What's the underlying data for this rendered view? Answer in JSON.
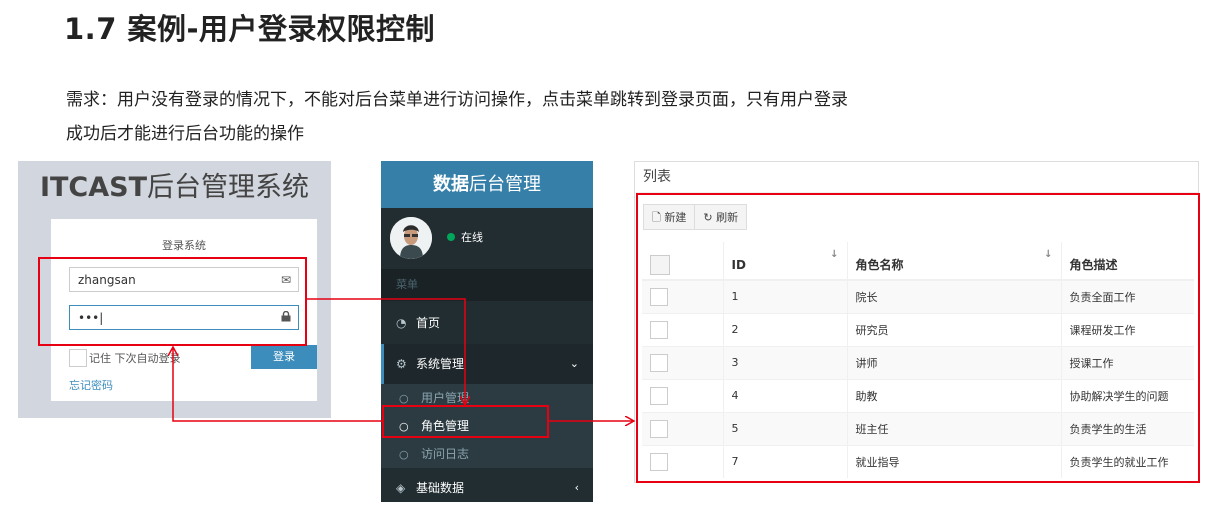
{
  "title": "1.7 案例-用户登录权限控制",
  "description": {
    "line1": "需求：用户没有登录的情况下，不能对后台菜单进行访问操作，点击菜单跳转到登录页面，只有用户登录",
    "line2": "成功后才能进行后台功能的操作"
  },
  "login": {
    "logo_bold": "ITCAST",
    "logo_rest": "后台管理系统",
    "box_msg": "登录系统",
    "username_value": "zhangsan",
    "password_value": "•••",
    "remember_label": "记住 下次自动登录",
    "login_button": "登录",
    "forgot_link": "忘记密码",
    "icons": {
      "username": "envelope-icon",
      "password": "lock-icon"
    }
  },
  "sidebar": {
    "logo_bold": "数据",
    "logo_rest": "后台管理",
    "status": "在线",
    "header": "菜单",
    "home": "首页",
    "system": "系统管理",
    "sub_items": [
      "用户管理",
      "角色管理",
      "访问日志"
    ],
    "basic": "基础数据"
  },
  "list": {
    "header": "列表",
    "new_button": "新建",
    "refresh_button": "刷新",
    "columns": [
      "ID",
      "角色名称",
      "角色描述"
    ],
    "rows": [
      {
        "id": "1",
        "name": "院长",
        "desc": "负责全面工作"
      },
      {
        "id": "2",
        "name": "研究员",
        "desc": "课程研发工作"
      },
      {
        "id": "3",
        "name": "讲师",
        "desc": "授课工作"
      },
      {
        "id": "4",
        "name": "助教",
        "desc": "协助解决学生的问题"
      },
      {
        "id": "5",
        "name": "班主任",
        "desc": "负责学生的生活"
      },
      {
        "id": "7",
        "name": "就业指导",
        "desc": "负责学生的就业工作"
      }
    ]
  },
  "colors": {
    "annotation_red": "#e60012",
    "brand_blue": "#3c8dbc",
    "sidebar_dark": "#222d32",
    "online_green": "#00a65a"
  }
}
